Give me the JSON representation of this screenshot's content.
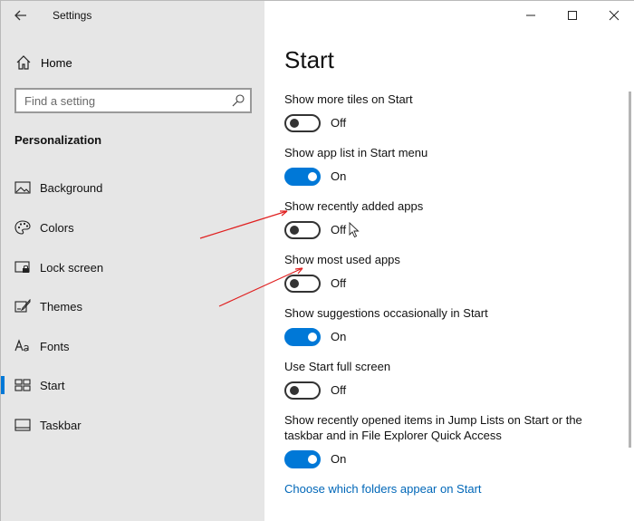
{
  "window": {
    "title": "Settings",
    "controls": [
      "minimize",
      "maximize",
      "close"
    ]
  },
  "sidebar": {
    "home_label": "Home",
    "search_placeholder": "Find a setting",
    "section_title": "Personalization",
    "items": [
      {
        "label": "Background",
        "icon": "picture-icon"
      },
      {
        "label": "Colors",
        "icon": "palette-icon"
      },
      {
        "label": "Lock screen",
        "icon": "lock-screen-icon"
      },
      {
        "label": "Themes",
        "icon": "themes-icon"
      },
      {
        "label": "Fonts",
        "icon": "fonts-icon"
      },
      {
        "label": "Start",
        "icon": "start-icon",
        "selected": true
      },
      {
        "label": "Taskbar",
        "icon": "taskbar-icon"
      }
    ]
  },
  "main": {
    "title": "Start",
    "settings": [
      {
        "label": "Show more tiles on Start",
        "state": "Off",
        "on": false
      },
      {
        "label": "Show app list in Start menu",
        "state": "On",
        "on": true
      },
      {
        "label": "Show recently added apps",
        "state": "Off",
        "on": false
      },
      {
        "label": "Show most used apps",
        "state": "Off",
        "on": false
      },
      {
        "label": "Show suggestions occasionally in Start",
        "state": "On",
        "on": true
      },
      {
        "label": "Use Start full screen",
        "state": "Off",
        "on": false
      },
      {
        "label": "Show recently opened items in Jump Lists on Start or the taskbar and in File Explorer Quick Access",
        "state": "On",
        "on": true
      }
    ],
    "link": "Choose which folders appear on Start"
  },
  "colors": {
    "accent": "#0078d7",
    "sidebar_bg": "#e6e6e6",
    "link": "#0067b8",
    "annotation_arrow": "#e02020"
  }
}
